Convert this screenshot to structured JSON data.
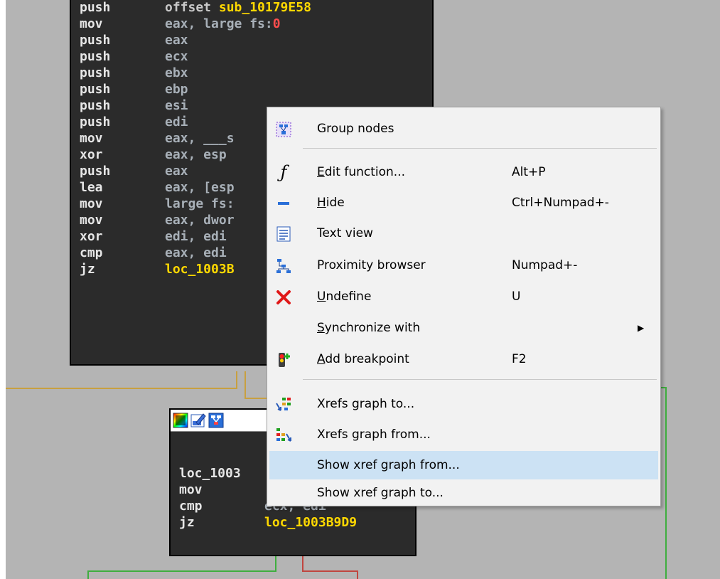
{
  "code_block_top": {
    "lines": [
      {
        "mnemonic": "push",
        "operand": "offset ",
        "operand_symbol": "sub_10179E58"
      },
      {
        "mnemonic": "mov",
        "operand": "eax, large fs:",
        "operand_number": "0"
      },
      {
        "mnemonic": "push",
        "operand": "eax"
      },
      {
        "mnemonic": "push",
        "operand": "ecx"
      },
      {
        "mnemonic": "push",
        "operand": "ebx"
      },
      {
        "mnemonic": "push",
        "operand": "ebp"
      },
      {
        "mnemonic": "push",
        "operand": "esi"
      },
      {
        "mnemonic": "push",
        "operand": "edi"
      },
      {
        "mnemonic": "mov",
        "operand": "eax, ___s"
      },
      {
        "mnemonic": "xor",
        "operand": "eax, esp"
      },
      {
        "mnemonic": "push",
        "operand": "eax"
      },
      {
        "mnemonic": "lea",
        "operand": "eax, [esp"
      },
      {
        "mnemonic": "mov",
        "operand": "large fs:"
      },
      {
        "mnemonic": "mov",
        "operand": "eax, dwor"
      },
      {
        "mnemonic": "xor",
        "operand": "edi, edi"
      },
      {
        "mnemonic": "cmp",
        "operand": "eax, edi"
      },
      {
        "mnemonic": "jz",
        "operand_symbol": "loc_1003B"
      }
    ]
  },
  "code_block_bottom": {
    "toolbar_icons": [
      "color-palette-icon",
      "edit-node-icon",
      "node-graph-icon"
    ],
    "label": "loc_1003",
    "lines": [
      {
        "mnemonic": "mov",
        "operand": ""
      },
      {
        "mnemonic": "cmp",
        "operand": "ecx, edi"
      },
      {
        "mnemonic": "jz",
        "operand_symbol": "loc_1003B9D9"
      }
    ]
  },
  "context_menu": {
    "items": [
      {
        "icon": "group-nodes-icon",
        "label": "Group nodes",
        "shortcut": ""
      },
      {
        "icon": "function-icon",
        "label": "Edit function...",
        "underline": "E",
        "shortcut": "Alt+P"
      },
      {
        "icon": "hide-icon",
        "label": "Hide",
        "underline": "H",
        "shortcut": "Ctrl+Numpad+-"
      },
      {
        "icon": "text-view-icon",
        "label": "Text view",
        "shortcut": ""
      },
      {
        "icon": "proximity-browser-icon",
        "label": "Proximity browser",
        "shortcut": "Numpad+-"
      },
      {
        "icon": "undefine-icon",
        "label": "Undefine",
        "underline": "U",
        "shortcut": "U"
      },
      {
        "icon": "",
        "label": "Synchronize with",
        "underline": "S",
        "shortcut": "",
        "submenu": "▶"
      },
      {
        "icon": "add-breakpoint-icon",
        "label": "Add breakpoint",
        "underline": "A",
        "shortcut": "F2"
      },
      {
        "icon": "xrefs-graph-to-icon",
        "label": "Xrefs graph to...",
        "shortcut": ""
      },
      {
        "icon": "xrefs-graph-from-icon",
        "label": "Xrefs graph from...",
        "shortcut": ""
      },
      {
        "icon": "",
        "label": "Show xref graph from...",
        "shortcut": "",
        "highlighted": true
      },
      {
        "icon": "",
        "label": "Show xref graph to...",
        "shortcut": ""
      }
    ]
  },
  "colors": {
    "graph_background": "#b4b4b4",
    "code_background": "#2b2b2b",
    "symbol": "#ffd800",
    "menu_highlight": "#cce2f4",
    "edge_yellow": "#c8a040",
    "edge_green": "#3fae3f",
    "edge_red": "#c0453f"
  }
}
